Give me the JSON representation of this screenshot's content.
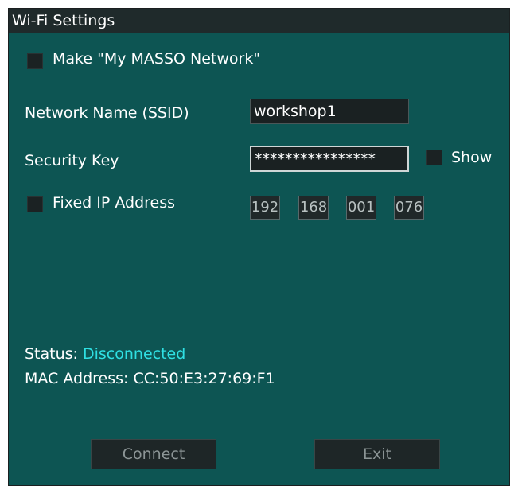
{
  "window": {
    "title": "Wi-Fi Settings"
  },
  "options": {
    "my_network_label": "Make \"My MASSO Network\"",
    "my_network_checked": false
  },
  "ssid": {
    "label": "Network Name (SSID)",
    "value": "workshop1"
  },
  "security": {
    "label": "Security Key",
    "value": "****************",
    "show_label": "Show",
    "show_checked": false
  },
  "fixed_ip": {
    "label": "Fixed IP Address",
    "checked": false,
    "octets": [
      "192",
      "168",
      "001",
      "076"
    ]
  },
  "status": {
    "label": "Status:",
    "value": "Disconnected",
    "mac_label": "MAC Address:",
    "mac_value": "CC:50:E3:27:69:F1"
  },
  "buttons": {
    "connect_label": "Connect",
    "exit_label": "Exit"
  },
  "colors": {
    "panel_bg": "#0d5553",
    "title_bg": "#1f2a2b",
    "status_value": "#2fe0e3"
  }
}
